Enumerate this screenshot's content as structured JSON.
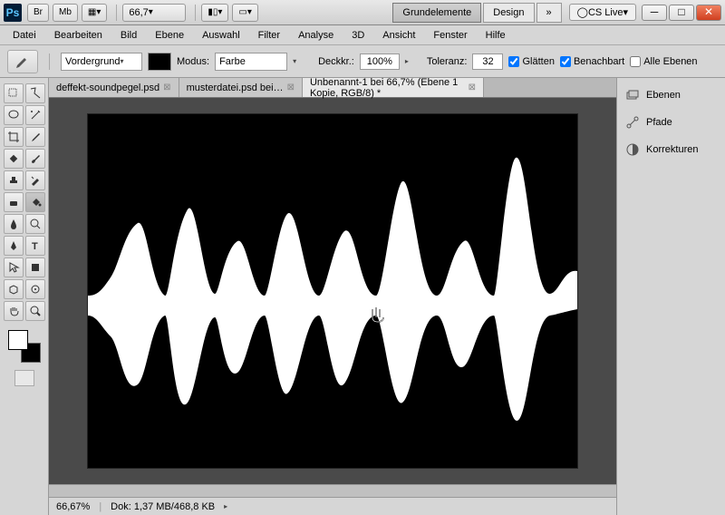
{
  "titlebar": {
    "zoom_value": "66,7",
    "ws_active": "Grundelemente",
    "ws_design": "Design",
    "cslive": "CS Live"
  },
  "menu": [
    "Datei",
    "Bearbeiten",
    "Bild",
    "Ebene",
    "Auswahl",
    "Filter",
    "Analyse",
    "3D",
    "Ansicht",
    "Fenster",
    "Hilfe"
  ],
  "options": {
    "fill_label": "Vordergrund",
    "mode_label": "Modus:",
    "mode_value": "Farbe",
    "opacity_label": "Deckkr.:",
    "opacity_value": "100%",
    "tolerance_label": "Toleranz:",
    "tolerance_value": "32",
    "antialias": "Glätten",
    "contiguous": "Benachbart",
    "all_layers": "Alle Ebenen"
  },
  "tabs": [
    {
      "label": "deffekt-soundpegel.psd"
    },
    {
      "label": "musterdatei.psd bei…"
    },
    {
      "label": "Unbenannt-1 bei 66,7% (Ebene 1 Kopie, RGB/8) *"
    }
  ],
  "status": {
    "zoom": "66,67%",
    "doc": "Dok: 1,37 MB/468,8 KB"
  },
  "panels": [
    "Ebenen",
    "Pfade",
    "Korrekturen"
  ]
}
